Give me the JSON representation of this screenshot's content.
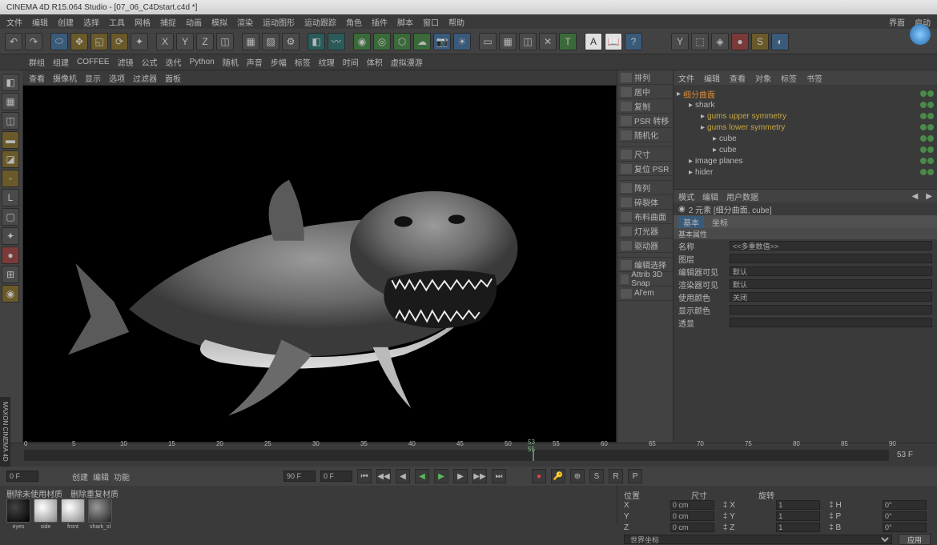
{
  "app": {
    "title": "CINEMA 4D R15.064 Studio - [07_06_C4Dstart.c4d *]"
  },
  "menu": {
    "items": [
      "文件",
      "编辑",
      "创建",
      "选择",
      "工具",
      "网格",
      "捕捉",
      "动画",
      "模拟",
      "渲染",
      "运动图形",
      "运动跟踪",
      "角色",
      "插件",
      "脚本",
      "窗口",
      "帮助"
    ],
    "right": [
      "界面",
      "启动"
    ]
  },
  "subtoolbar": {
    "items": [
      "群组",
      "组建",
      "COFFEE",
      "滤镜",
      "公式",
      "迭代",
      "Python",
      "随机",
      "声音",
      "步幅",
      "标签",
      "纹理",
      "时间",
      "体积",
      "虚拟漫游"
    ]
  },
  "viewport_menu": {
    "items": [
      "查看",
      "摄像机",
      "显示",
      "选项",
      "过滤器",
      "面板"
    ]
  },
  "palette": {
    "rows": [
      "排列",
      "居中",
      "复制",
      "PSR 转移",
      "随机化",
      "",
      "尺寸",
      "复位 PSR",
      "",
      "阵列",
      "碎裂体",
      "布料曲面",
      "灯光器",
      "驱动器",
      "",
      "编辑选择",
      "Attrib 3D Snap",
      "Al'em"
    ]
  },
  "objects": {
    "tabs": [
      "文件",
      "编辑",
      "查看",
      "对象",
      "标签",
      "书签"
    ],
    "tree": [
      {
        "name": "细分曲面",
        "cls": "orange",
        "indent": 0
      },
      {
        "name": "shark",
        "cls": "",
        "indent": 1
      },
      {
        "name": "gums upper symmetry",
        "cls": "yellow",
        "indent": 2
      },
      {
        "name": "gums lower symmetry",
        "cls": "yellow",
        "indent": 2
      },
      {
        "name": "cube",
        "cls": "",
        "indent": 3
      },
      {
        "name": "cube",
        "cls": "",
        "indent": 3
      },
      {
        "name": "image planes",
        "cls": "",
        "indent": 1
      },
      {
        "name": "hider",
        "cls": "",
        "indent": 1
      }
    ]
  },
  "attributes": {
    "tabs": [
      "模式",
      "编辑",
      "用户数据"
    ],
    "object_info": "2 元素 [细分曲面, cube]",
    "section_tabs": [
      "基本",
      "坐标"
    ],
    "section": "基本属性",
    "rows": [
      {
        "label": "名称",
        "value": "<<多重数值>>"
      },
      {
        "label": "图层",
        "value": ""
      },
      {
        "label": "编辑器可见",
        "value": "默认"
      },
      {
        "label": "渲染器可见",
        "value": "默认"
      },
      {
        "label": "使用颜色",
        "value": "关闭"
      },
      {
        "label": "显示颜色",
        "value": ""
      },
      {
        "label": "透显",
        "value": ""
      }
    ]
  },
  "timeline": {
    "ticks": [
      "0",
      "5",
      "10",
      "15",
      "20",
      "25",
      "30",
      "35",
      "40",
      "45",
      "50",
      "55",
      "60",
      "65",
      "70",
      "75",
      "80",
      "85",
      "90"
    ],
    "current": "53",
    "current_label": "53 55",
    "end_label": "53 F"
  },
  "playback": {
    "start": "0 F",
    "end": "90 F",
    "current": "0 F"
  },
  "materials": {
    "tabs": [
      "删除未使用材质",
      "删除重复材质"
    ],
    "items": [
      {
        "name": "eyes",
        "cls": "dark"
      },
      {
        "name": "side",
        "cls": "white"
      },
      {
        "name": "front",
        "cls": "white"
      },
      {
        "name": "shark_sl",
        "cls": ""
      }
    ]
  },
  "coords": {
    "tabs": [
      "位置",
      "尺寸",
      "旋转"
    ],
    "values": {
      "x_pos": "0 cm",
      "x_scl": "1",
      "x_rot": "0°",
      "y_pos": "0 cm",
      "y_scl": "1",
      "y_rot": "0°",
      "z_pos": "0 cm",
      "z_scl": "1",
      "z_rot": "0°"
    },
    "dropdown": "世界坐标",
    "apply": "应用"
  },
  "vert_label": "MAXON CINEMA 4D"
}
